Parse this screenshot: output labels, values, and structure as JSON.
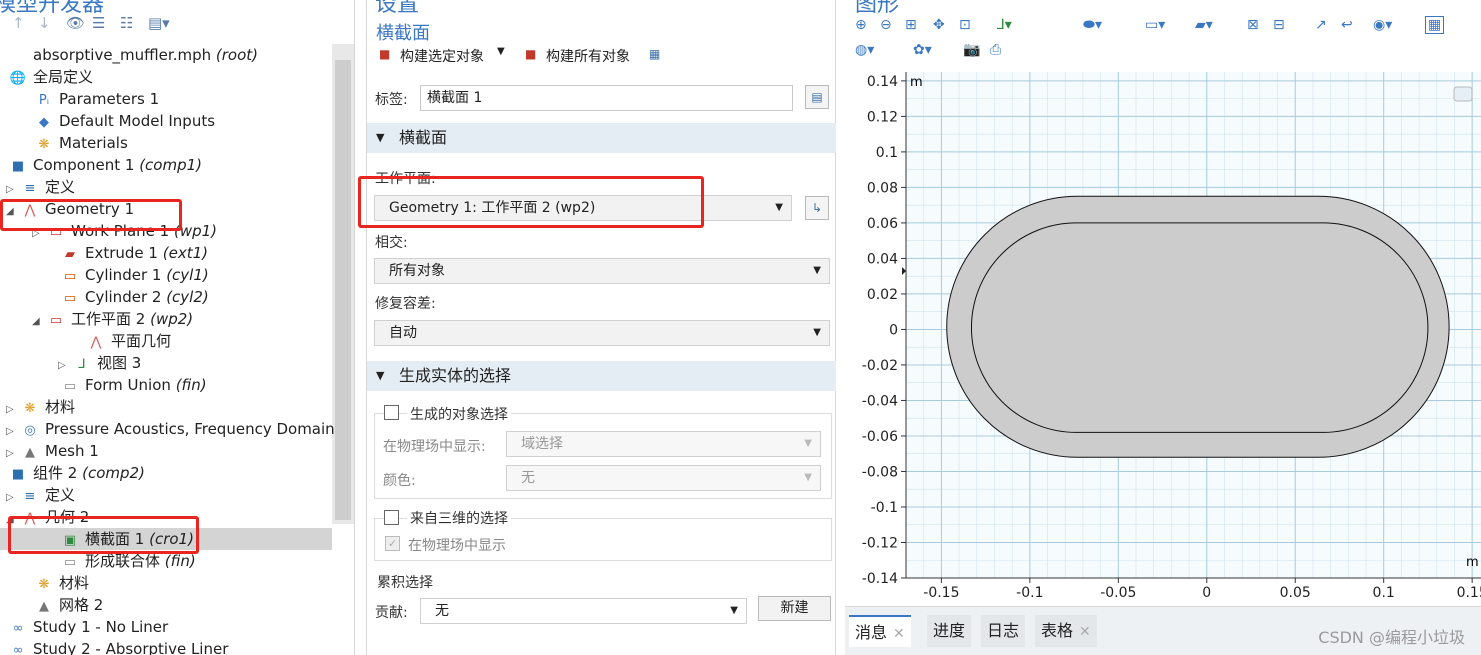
{
  "tree": {
    "title": "模型开发器",
    "items": [
      {
        "label": "absorptive_muffler.mph",
        "tag": "(root)",
        "icon": "file-icon"
      },
      {
        "label": "全局定义",
        "tag": "",
        "icon": "globe-icon"
      },
      {
        "label": "Parameters 1",
        "tag": "",
        "icon": "parameters-icon"
      },
      {
        "label": "Default Model Inputs",
        "tag": "",
        "icon": "model-inputs-icon"
      },
      {
        "label": "Materials",
        "tag": "",
        "icon": "materials-icon"
      },
      {
        "label": "Component 1",
        "tag": "(comp1)",
        "icon": "component-icon"
      },
      {
        "label": "定义",
        "tag": "",
        "icon": "definitions-icon"
      },
      {
        "label": "Geometry 1",
        "tag": "",
        "icon": "geometry-icon"
      },
      {
        "label": "Work Plane 1",
        "tag": "(wp1)",
        "icon": "work-plane-icon"
      },
      {
        "label": "Extrude 1",
        "tag": "(ext1)",
        "icon": "extrude-icon"
      },
      {
        "label": "Cylinder 1",
        "tag": "(cyl1)",
        "icon": "cylinder-icon"
      },
      {
        "label": "Cylinder 2",
        "tag": "(cyl2)",
        "icon": "cylinder-icon"
      },
      {
        "label": "工作平面 2",
        "tag": "(wp2)",
        "icon": "work-plane-icon"
      },
      {
        "label": "平面几何",
        "tag": "",
        "icon": "plane-geometry-icon"
      },
      {
        "label": "视图 3",
        "tag": "",
        "icon": "view-icon"
      },
      {
        "label": "Form Union",
        "tag": "(fin)",
        "icon": "form-union-icon"
      },
      {
        "label": "材料",
        "tag": "",
        "icon": "materials-icon"
      },
      {
        "label": "Pressure Acoustics, Frequency Domain",
        "tag": "",
        "icon": "acoustics-icon"
      },
      {
        "label": "Mesh 1",
        "tag": "",
        "icon": "mesh-icon"
      },
      {
        "label": "组件 2",
        "tag": "(comp2)",
        "icon": "component-icon"
      },
      {
        "label": "定义",
        "tag": "",
        "icon": "definitions-icon"
      },
      {
        "label": "几何 2",
        "tag": "",
        "icon": "geometry-icon"
      },
      {
        "label": "横截面 1",
        "tag": "(cro1)",
        "icon": "cross-section-icon"
      },
      {
        "label": "形成联合体",
        "tag": "(fin)",
        "icon": "form-union-icon"
      },
      {
        "label": "材料",
        "tag": "",
        "icon": "materials-icon"
      },
      {
        "label": "网格 2",
        "tag": "",
        "icon": "mesh-icon"
      },
      {
        "label": "Study 1 - No Liner",
        "tag": "",
        "icon": "study-icon"
      },
      {
        "label": "Study 2 - Absorptive Liner",
        "tag": "",
        "icon": "study-icon"
      }
    ]
  },
  "settings": {
    "title": "设置",
    "subtitle": "横截面",
    "build_selected": "构建选定对象",
    "build_all": "构建所有对象",
    "label_caption": "标签:",
    "label_value": "横截面 1",
    "section1": "横截面",
    "workplane_caption": "工作平面:",
    "workplane_value": "Geometry 1: 工作平面 2 (wp2)",
    "intersect_caption": "相交:",
    "intersect_value": "所有对象",
    "tolerance_caption": "修复容差:",
    "tolerance_value": "自动",
    "section2": "生成实体的选择",
    "gen_selection": "生成的对象选择",
    "show_in_physics_caption": "在物理场中显示:",
    "show_in_physics_value": "域选择",
    "color_caption": "颜色:",
    "color_value": "无",
    "from_3d": "来自三维的选择",
    "show_in_physics_check": "在物理场中显示",
    "cumulative": "累积选择",
    "contribute_caption": "贡献:",
    "contribute_value": "无",
    "new_button": "新建"
  },
  "graphics": {
    "title": "图形",
    "unit_y": "m",
    "unit_x": "m",
    "tabs": [
      "消息",
      "进度",
      "日志",
      "表格"
    ],
    "watermark": "CSDN @编程小垃圾"
  },
  "chart_data": {
    "type": "scatter",
    "title": "",
    "xlabel": "m",
    "ylabel": "m",
    "xlim": [
      -0.17,
      0.155
    ],
    "ylim": [
      -0.14,
      0.145
    ],
    "x_ticks": [
      -0.15,
      -0.1,
      -0.05,
      0,
      0.05,
      0.1,
      0.15
    ],
    "y_ticks": [
      0.14,
      0.12,
      0.1,
      0.08,
      0.06,
      0.04,
      0.02,
      0,
      -0.02,
      -0.04,
      -0.06,
      -0.08,
      -0.1,
      -0.12,
      -0.14
    ],
    "x_tick_labels": [
      "-0.15",
      "-0.1",
      "-0.05",
      "0",
      "0.05",
      "0.1",
      "0.15"
    ],
    "y_tick_labels": [
      "0.14",
      "0.12",
      "0.1",
      "0.08",
      "0.06",
      "0.04",
      "0.02",
      "0",
      "-0.02",
      "-0.04",
      "-0.06",
      "-0.08",
      "-0.1",
      "-0.12",
      "-0.14"
    ],
    "grid": true,
    "shapes": [
      {
        "name": "outer",
        "x_range": [
          -0.147,
          0.137
        ],
        "y_range": [
          -0.072,
          0.075
        ]
      },
      {
        "name": "inner",
        "x_range": [
          -0.133,
          0.125
        ],
        "y_range": [
          -0.058,
          0.06
        ]
      }
    ],
    "colors": {
      "fill": "#cccccc",
      "grid": "#cfe3ee",
      "background": "#f6fbfd"
    }
  }
}
